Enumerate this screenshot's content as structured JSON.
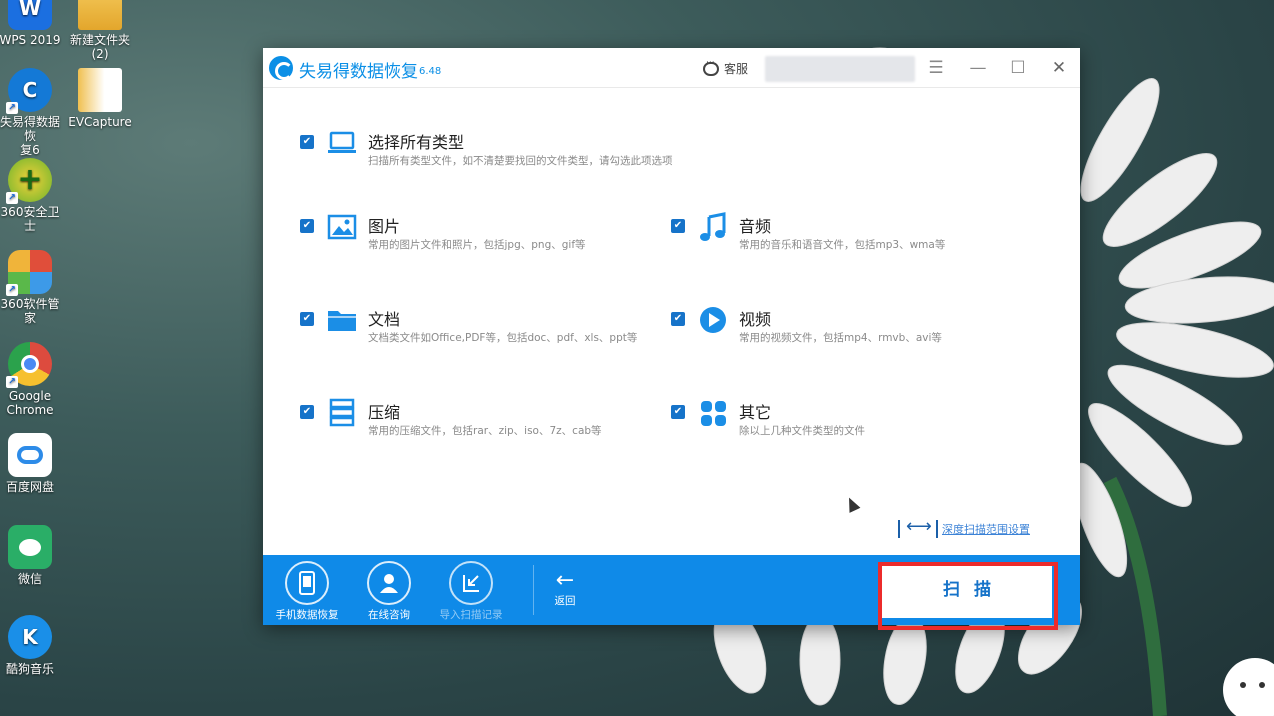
{
  "desktop": {
    "icons": [
      {
        "label": "WPS 2019",
        "name": "wps-icon",
        "color": "#1b6fe0",
        "glyph": "W"
      },
      {
        "label": "新建文件夹\n(2)",
        "name": "folder-icon",
        "color": "#e8b43a",
        "glyph": ""
      },
      {
        "label": "失易得数据恢\n复6",
        "name": "recovery-app-icon",
        "color": "#1479d6",
        "glyph": "C"
      },
      {
        "label": "EVCapture",
        "name": "evcapture-icon",
        "color": "#e6a52a",
        "glyph": ""
      },
      {
        "label": "360安全卫士",
        "name": "360-security-icon",
        "color": "#6cb42c",
        "glyph": "+"
      },
      {
        "label": "360软件管家",
        "name": "360-software-icon",
        "color": "#e04e3a",
        "glyph": ""
      },
      {
        "label": "Google\nChrome",
        "name": "chrome-icon",
        "color": "#dd4b3e",
        "glyph": ""
      },
      {
        "label": "百度网盘",
        "name": "baidu-netdisk-icon",
        "color": "#ffffff",
        "glyph": ""
      },
      {
        "label": "微信",
        "name": "wechat-icon",
        "color": "#2aae67",
        "glyph": ""
      },
      {
        "label": "酷狗音乐",
        "name": "kugou-icon",
        "color": "#1a8fe8",
        "glyph": "K"
      }
    ]
  },
  "window": {
    "title": "失易得数据恢复",
    "version": "6.48",
    "kefu_label": "客服",
    "account_value": "",
    "menu_glyph": "☰",
    "min_glyph": "—",
    "max_glyph": "☐",
    "close_glyph": "✕"
  },
  "options": {
    "check_glyph": "✔",
    "all": {
      "title": "选择所有类型",
      "desc": "扫描所有类型文件，如不清楚要找回的文件类型，请勾选此项选项",
      "checked": true,
      "icon": "laptop-icon"
    },
    "pictures": {
      "title": "图片",
      "desc": "常用的图片文件和照片，包括jpg、png、gif等",
      "checked": true,
      "icon": "image-icon"
    },
    "audio": {
      "title": "音频",
      "desc": "常用的音乐和语音文件，包括mp3、wma等",
      "checked": true,
      "icon": "music-note-icon"
    },
    "documents": {
      "title": "文档",
      "desc": "文档类文件如Office,PDF等，包括doc、pdf、xls、ppt等",
      "checked": true,
      "icon": "folder-icon"
    },
    "video": {
      "title": "视频",
      "desc": "常用的视频文件，包括mp4、rmvb、avi等",
      "checked": true,
      "icon": "play-icon"
    },
    "archive": {
      "title": "压缩",
      "desc": "常用的压缩文件，包括rar、zip、iso、7z、cab等",
      "checked": true,
      "icon": "archive-icon"
    },
    "other": {
      "title": "其它",
      "desc": "除以上几种文件类型的文件",
      "checked": true,
      "icon": "grid-icon"
    }
  },
  "deep_scan_link": "深度扫描范围设置",
  "bottom": {
    "phone_recovery": "手机数据恢复",
    "online_consult": "在线咨询",
    "import_record": "导入扫描记录",
    "back": "返回",
    "scan": "扫描"
  },
  "colors": {
    "accent": "#0f8ae8",
    "highlight": "#ec2b2b",
    "check": "#1673c9"
  }
}
